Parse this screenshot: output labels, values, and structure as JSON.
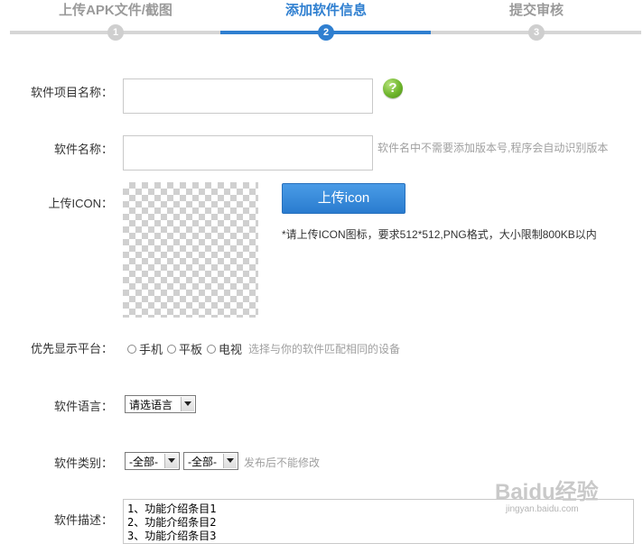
{
  "stepper": {
    "steps": [
      {
        "label": "上传APK文件/截图",
        "number": "1",
        "active": false
      },
      {
        "label": "添加软件信息",
        "number": "2",
        "active": true
      },
      {
        "label": "提交审核",
        "number": "3",
        "active": false
      }
    ],
    "active_color": "#2f7fd0",
    "inactive_color": "#d6d6d6"
  },
  "form": {
    "project_name": {
      "label": "软件项目名称：",
      "value": "",
      "help_icon": "question-icon"
    },
    "software_name": {
      "label": "软件名称：",
      "value": "",
      "hint": "软件名中不需要添加版本号,程序会自动识别版本"
    },
    "icon": {
      "label": "上传ICON：",
      "button_label": "上传icon",
      "note": "*请上传ICON图标，要求512*512,PNG格式，大小限制800KB以内"
    },
    "platform": {
      "label": "优先显示平台：",
      "options": [
        "手机",
        "平板",
        "电视"
      ],
      "hint": "选择与你的软件匹配相同的设备"
    },
    "language": {
      "label": "软件语言：",
      "selected": "请选语言"
    },
    "category": {
      "label": "软件类别：",
      "selected_1": "-全部-",
      "selected_2": "-全部-",
      "hint": "发布后不能修改"
    },
    "description": {
      "label": "软件描述：",
      "lines": [
        "1、功能介绍条目1",
        "2、功能介绍条目2",
        "3、功能介绍条目3"
      ]
    }
  },
  "watermark": {
    "brand": "Baidu经验",
    "url": "jingyan.baidu.com"
  }
}
